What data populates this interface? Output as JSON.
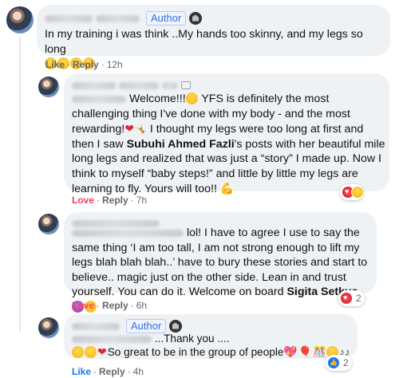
{
  "comments": [
    {
      "author_badge": "Author",
      "text": "In my training i was think ..My hands too skinny, and my legs so long",
      "actions": {
        "like": "Like",
        "reply": "Reply",
        "time": "12h"
      }
    },
    {
      "text_1": " Welcome!!!",
      "text_2": " YFS is definitely the most challenging thing I've done with my body - and the most rewarding!",
      "text_3": " I thought my legs were too long at first and then I saw ",
      "mention": "Subuhi Ahmed Fazli",
      "text_4": "'s posts with her beautiful mile long legs and realized that was just a “story” I made up. Now I think to myself “baby steps!” and little by little my legs are learning to fly. Yours will too!!",
      "actions": {
        "react": "Love",
        "reply": "Reply",
        "time": "7h"
      }
    },
    {
      "text_1": " lol! I have to agree I use to say the same thing ‘I am too tall, I am not strong enough to lift my legs blah blah blah..’ have to bury these stories and start to believe.. magic just on the other side. Lean in and trust yourself. You can do it. Welcome on board ",
      "mention": "Sigita Setkus",
      "actions": {
        "react": "Love",
        "reply": "Reply",
        "time": "6h"
      },
      "reactions_count": "2"
    },
    {
      "author_badge": "Author",
      "text_1": " ...Thank you ....",
      "text_2": "So great to be in the group of people",
      "actions": {
        "like": "Like",
        "reply": "Reply",
        "time": "4h"
      },
      "reactions_count": "2"
    }
  ],
  "colors": {
    "bubble": "#eff2f5",
    "love": "#f33e58",
    "meta": "#65676b",
    "badge": "#3a6fd8",
    "like_blue": "#1877f2"
  },
  "icons": [
    "hand-wave-icon",
    "love-reaction-icon",
    "haha-reaction-icon",
    "like-reaction-icon",
    "smile-emoji",
    "heart-emoji"
  ]
}
